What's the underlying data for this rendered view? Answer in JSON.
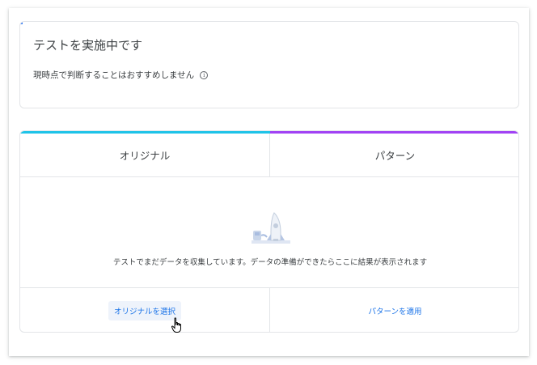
{
  "status": {
    "title": "テストを実施中です",
    "subtitle": "現時点で判断することはおすすめしません",
    "info_icon": "i"
  },
  "compare": {
    "columns": [
      {
        "label": "オリジナル",
        "accent": "#1fc3e8"
      },
      {
        "label": "パターン",
        "accent": "#a142f4"
      }
    ],
    "empty_message": "テストでまだデータを収集しています。データの準備ができたらここに結果が表示されます",
    "illustration_icon": "rocket-icon",
    "actions": {
      "select_original": "オリジナルを選択",
      "apply_variant": "パターンを適用"
    }
  },
  "colors": {
    "link": "#1a73e8",
    "status_accent": "#4285f4"
  }
}
